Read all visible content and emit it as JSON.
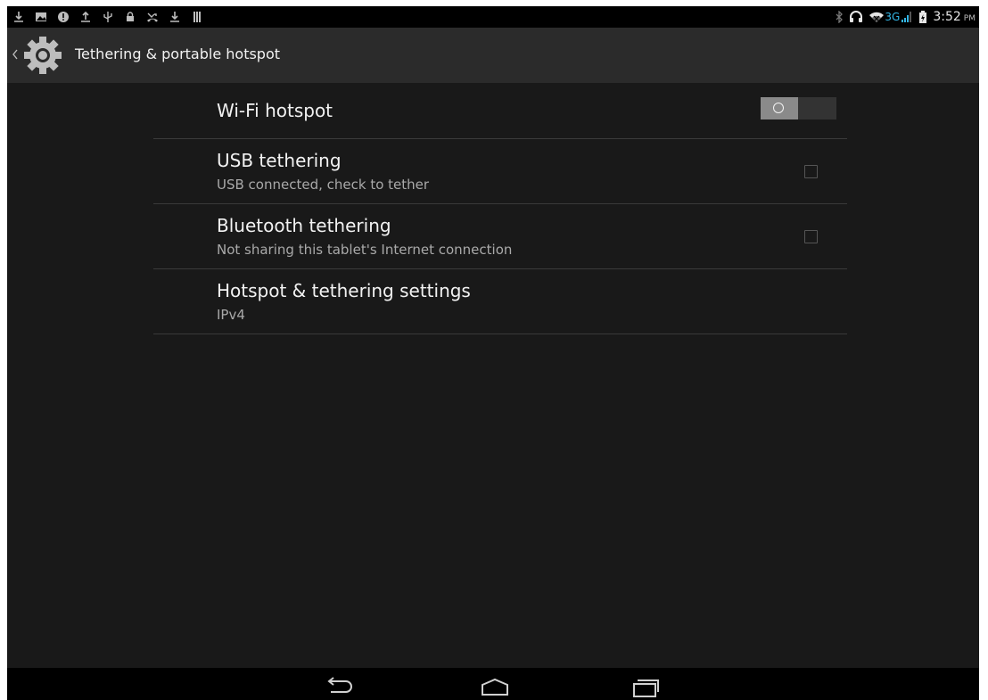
{
  "status_bar": {
    "left_icons": [
      "download-icon",
      "gallery-icon",
      "alert-icon",
      "upload-icon",
      "usb-icon",
      "lock-icon",
      "missed-call-icon",
      "download-icon",
      "storage-icon"
    ],
    "right_icons": [
      "bluetooth-icon",
      "headset-icon",
      "wifi-icon",
      "signal-icon",
      "battery-icon"
    ],
    "network_type": "3G",
    "time": "3:52",
    "ampm": "PM"
  },
  "action_bar": {
    "title": "Tethering & portable hotspot"
  },
  "settings": {
    "wifi_hotspot": {
      "title": "Wi-Fi hotspot",
      "enabled": false
    },
    "usb_tethering": {
      "title": "USB tethering",
      "summary": "USB connected, check to tether",
      "checked": false
    },
    "bluetooth_tethering": {
      "title": "Bluetooth tethering",
      "summary": "Not sharing this tablet's Internet connection",
      "checked": false
    },
    "hotspot_settings": {
      "title": "Hotspot & tethering settings",
      "summary": "IPv4"
    }
  },
  "nav_bar": {
    "buttons": [
      "back-icon",
      "home-icon",
      "recents-icon"
    ]
  },
  "colors": {
    "accent": "#33b5e5",
    "background": "#191919",
    "action_bar": "#2b2b2b"
  }
}
